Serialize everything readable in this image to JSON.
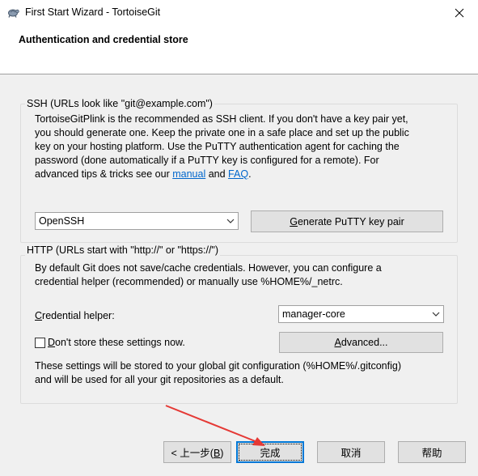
{
  "window": {
    "title": "First Start Wizard - TortoiseGit"
  },
  "header": {
    "title": "Authentication and credential store"
  },
  "ssh": {
    "group_label": "SSH (URLs look like \"git@example.com\")",
    "desc_1": "TortoiseGitPlink is the recommended as SSH client. If you don't have a key pair yet,",
    "desc_2": "you should generate one. Keep the private one in a safe place and set up the public",
    "desc_3": "key on your hosting platform. Use the PuTTY authentication agent for caching the",
    "desc_4": "password (done automatically if a PuTTY key is configured for a remote). For",
    "desc_5_pre": "advanced tips & tricks see our ",
    "manual_link": "manual",
    "desc_5_mid": " and ",
    "faq_link": "FAQ",
    "desc_5_post": ".",
    "client_selected": "OpenSSH",
    "generate_button_pre": "",
    "generate_button_mnemonic": "G",
    "generate_button_rest": "enerate PuTTY  key pair"
  },
  "http": {
    "group_label": "HTTP (URLs start with \"http://\" or \"https://\")",
    "desc_1": "By default Git does not save/cache credentials. However, you can configure a",
    "desc_2": "credential helper (recommended) or manually use %HOME%/_netrc.",
    "helper_label_mnemonic": "C",
    "helper_label_rest": "redential helper:",
    "helper_selected": "manager-core",
    "dont_store_mnemonic": "D",
    "dont_store_rest": "on't store these settings now.",
    "advanced_mnemonic": "A",
    "advanced_rest": "dvanced...",
    "note_1": "These settings will be stored to your global git configuration (%HOME%/.gitconfig)",
    "note_2": "and will be used for all your git repositories as a default."
  },
  "footer": {
    "back_button": "< 上一步(",
    "back_mnemonic": "B",
    "back_close": ")",
    "finish_button": "完成",
    "cancel_button": "取消",
    "help_button": "帮助"
  },
  "colors": {
    "accent": "#0078d7",
    "link": "#0066cc",
    "annotation_arrow": "#e53935"
  }
}
